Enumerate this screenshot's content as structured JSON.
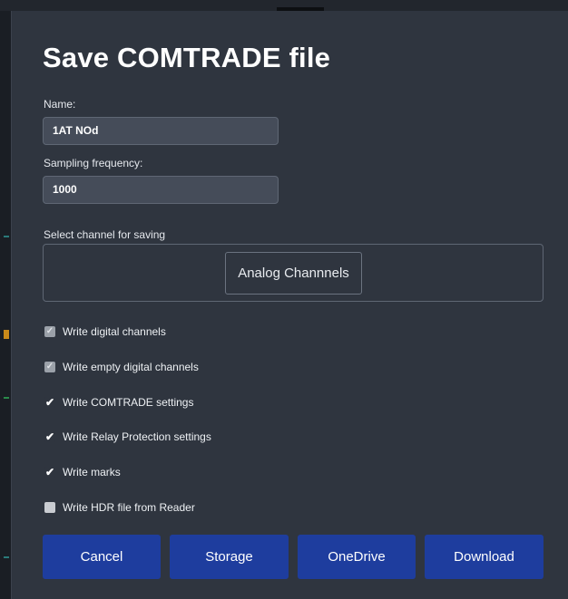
{
  "dialog": {
    "title": "Save COMTRADE file"
  },
  "name_field": {
    "label": "Name:",
    "value": "1AT NOd"
  },
  "frequency_field": {
    "label": "Sampling frequency:",
    "value": "1000"
  },
  "channel_select": {
    "label": "Select channel for saving",
    "button_label": "Analog Channnels"
  },
  "options": [
    {
      "label": "Write digital channels",
      "state": "checked-disabled"
    },
    {
      "label": "Write empty digital channels",
      "state": "checked-disabled"
    },
    {
      "label": "Write COMTRADE settings",
      "state": "checked"
    },
    {
      "label": "Write Relay Protection settings",
      "state": "checked"
    },
    {
      "label": "Write marks",
      "state": "checked"
    },
    {
      "label": "Write HDR file from Reader",
      "state": "unchecked"
    }
  ],
  "actions": {
    "cancel": "Cancel",
    "storage": "Storage",
    "onedrive": "OneDrive",
    "download": "Download"
  },
  "colors": {
    "dialog_bg": "#2f353f",
    "input_bg": "#454c59",
    "button_primary": "#1e3d9e"
  },
  "icons": {
    "check": "checkmark-icon"
  }
}
